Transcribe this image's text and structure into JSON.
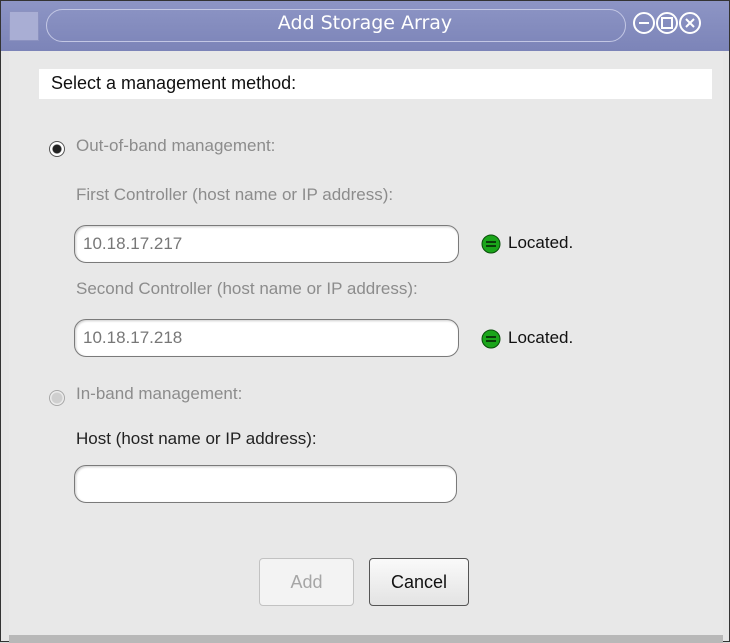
{
  "window": {
    "title": "Add Storage Array"
  },
  "header": {
    "text": "Select a management method:"
  },
  "out_of_band": {
    "label": "Out-of-band management:",
    "first_label": "First Controller (host name or IP address):",
    "first_value": "10.18.17.217",
    "first_status": "Located.",
    "second_label": "Second Controller (host name or IP address):",
    "second_value": "10.18.17.218",
    "second_status": "Located."
  },
  "in_band": {
    "label": "In-band management:",
    "host_label": "Host (host name or IP address):",
    "host_value": ""
  },
  "buttons": {
    "add": "Add",
    "cancel": "Cancel"
  },
  "colors": {
    "titlebar": "#7c84b8",
    "status_ok": "#1aa51a"
  },
  "icons": {
    "status": "green-status-icon",
    "minimize": "minimize-icon",
    "maximize": "maximize-icon",
    "close": "close-icon"
  }
}
